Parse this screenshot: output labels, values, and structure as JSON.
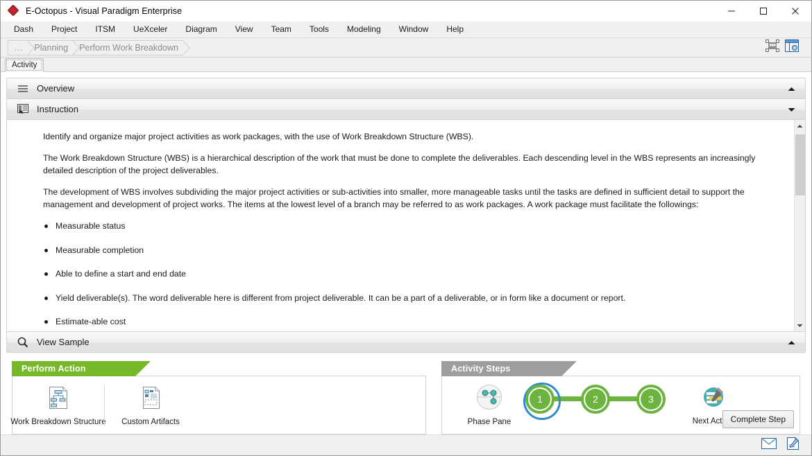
{
  "window": {
    "title": "E-Octopus - Visual Paradigm Enterprise",
    "logo_icon": "diamond-logo-icon",
    "minimize_label": "—",
    "maximize_label": "□",
    "close_label": "✕"
  },
  "menu": {
    "items": [
      {
        "label": "Dash"
      },
      {
        "label": "Project"
      },
      {
        "label": "ITSM"
      },
      {
        "label": "UeXceler"
      },
      {
        "label": "Diagram"
      },
      {
        "label": "View"
      },
      {
        "label": "Team"
      },
      {
        "label": "Tools"
      },
      {
        "label": "Modeling"
      },
      {
        "label": "Window"
      },
      {
        "label": "Help"
      }
    ]
  },
  "breadcrumb": {
    "items": [
      {
        "label": "..."
      },
      {
        "label": "Planning"
      },
      {
        "label": "Perform Work Breakdown"
      }
    ],
    "tools": [
      {
        "name": "fit-diagram-icon"
      },
      {
        "name": "open-window-icon"
      }
    ]
  },
  "tabs": [
    {
      "label": "Activity",
      "selected": true
    }
  ],
  "sections": {
    "overview": {
      "title": "Overview",
      "icon": "hamburger-icon",
      "chevron": "chevron-up-icon",
      "expanded": false
    },
    "instruction": {
      "title": "Instruction",
      "icon": "instruction-panel-icon",
      "chevron": "chevron-down-icon",
      "expanded": true,
      "paragraphs": [
        "Identify and organize major project activities as work packages, with the use of Work Breakdown Structure (WBS).",
        "The Work Breakdown Structure (WBS) is a hierarchical description of the work that must be done to complete the deliverables. Each descending level in the WBS represents an increasingly detailed description of the project deliverables.",
        "The development of WBS involves subdividing the major project activities or sub-activities into smaller, more manageable tasks until the tasks are defined in sufficient detail to support the management and development of project works. The items at the lowest level of a branch may be referred to as work packages. A work package must facilitate the followings:"
      ],
      "bullets": [
        "Measurable status",
        "Measurable completion",
        "Able to define a start and end date",
        "Yield deliverable(s). The word deliverable here is different from project deliverable. It can be a part of a deliverable, or in form like a document or report.",
        "Estimate-able cost"
      ]
    },
    "view_sample": {
      "title": "View Sample",
      "icon": "magnifier-icon",
      "chevron": "chevron-up-icon"
    }
  },
  "perform_action": {
    "tag_label": "Perform Action",
    "tag_color": "#76b82a",
    "artifacts": [
      {
        "label": "Work Breakdown Structure",
        "icon": "wbs-document-icon"
      },
      {
        "label": "Custom Artifacts",
        "icon": "custom-artifact-document-icon"
      }
    ]
  },
  "activity_steps": {
    "tag_label": "Activity Steps",
    "tag_color": "#9d9d9d",
    "phase_pane": {
      "label": "Phase Pane",
      "icon": "phase-pane-icon"
    },
    "steps": [
      {
        "number": "1",
        "active": true
      },
      {
        "number": "2",
        "active": false
      },
      {
        "number": "3",
        "active": false
      }
    ],
    "active_color": "#2e8bd0",
    "step_color": "#6cb33f",
    "next_activity": {
      "label": "Next Activity",
      "icon": "next-activity-icon"
    },
    "complete_button": "Complete Step"
  },
  "statusbar": {
    "icons": [
      {
        "name": "envelope-icon"
      },
      {
        "name": "document-edit-icon"
      }
    ]
  }
}
